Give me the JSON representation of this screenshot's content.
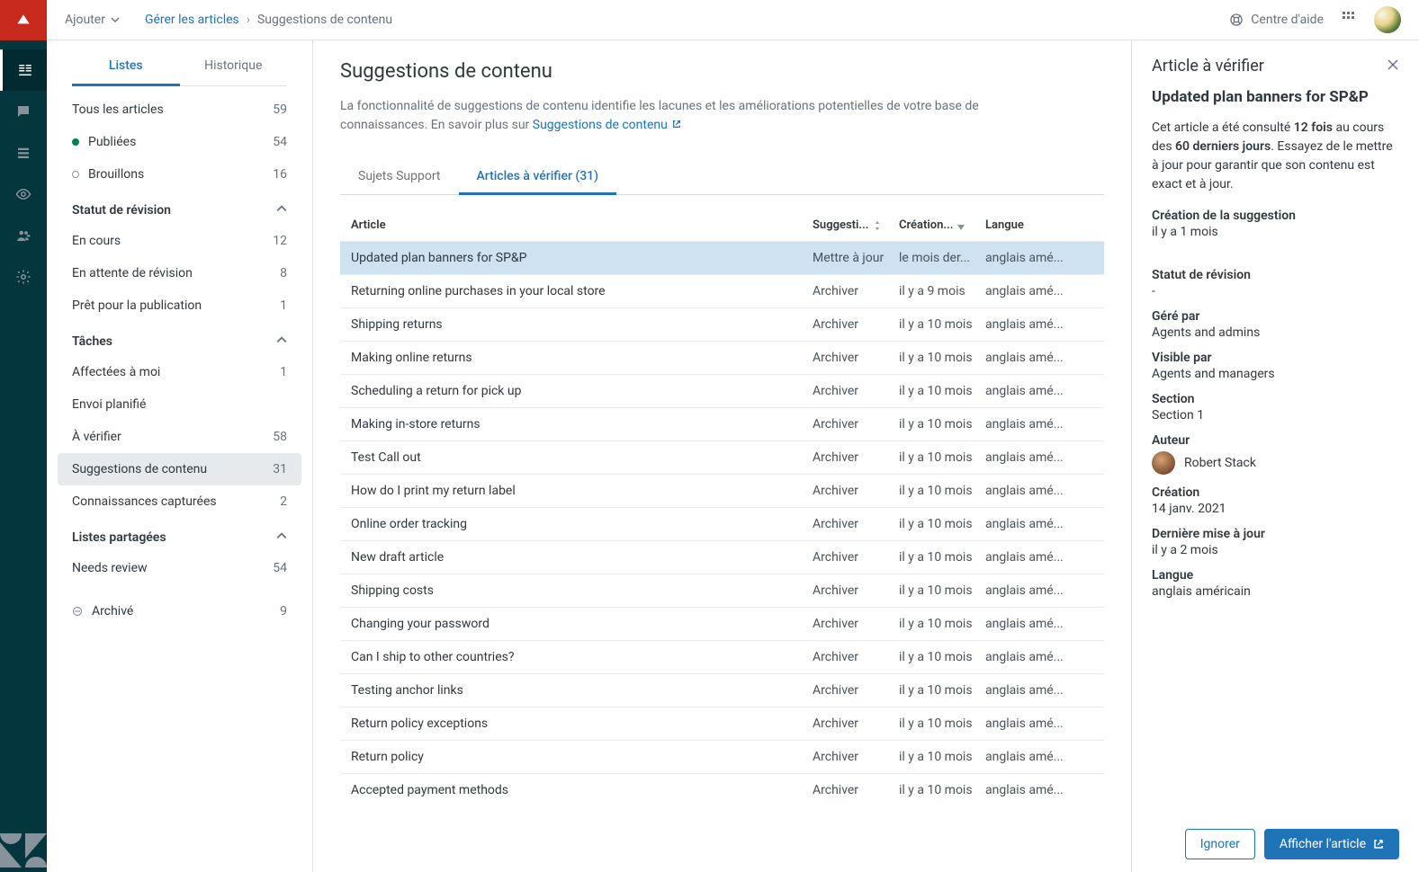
{
  "topbar": {
    "add_label": "Ajouter",
    "breadcrumb_link": "Gérer les articles",
    "breadcrumb_current": "Suggestions de contenu",
    "help_label": "Centre d'aide"
  },
  "sidebar": {
    "tabs": {
      "lists": "Listes",
      "history": "Historique"
    },
    "all_articles": {
      "label": "Tous les articles",
      "count": "59"
    },
    "published": {
      "label": "Publiées",
      "count": "54"
    },
    "drafts": {
      "label": "Brouillons",
      "count": "16"
    },
    "revision_header": "Statut de révision",
    "revision": [
      {
        "label": "En cours",
        "count": "12"
      },
      {
        "label": "En attente de révision",
        "count": "8"
      },
      {
        "label": "Prêt pour la publication",
        "count": "1"
      }
    ],
    "tasks_header": "Tâches",
    "tasks": [
      {
        "label": "Affectées à moi",
        "count": "1"
      },
      {
        "label": "Envoi planifié",
        "count": ""
      },
      {
        "label": "À vérifier",
        "count": "58"
      },
      {
        "label": "Suggestions de contenu",
        "count": "31"
      },
      {
        "label": "Connaissances capturées",
        "count": "2"
      }
    ],
    "shared_header": "Listes partagées",
    "shared": [
      {
        "label": "Needs review",
        "count": "54"
      }
    ],
    "archived": {
      "label": "Archivé",
      "count": "9"
    }
  },
  "content": {
    "title": "Suggestions de contenu",
    "desc_prefix": "La fonctionnalité de suggestions de contenu identifie les lacunes et les améliorations potentielles de votre base de connaissances. En savoir plus sur ",
    "desc_link": "Suggestions de contenu",
    "tabs": {
      "support": "Sujets Support",
      "verify": "Articles à vérifier (31)"
    },
    "columns": {
      "article": "Article",
      "suggestion": "Suggesti...",
      "creation": "Création...",
      "language": "Langue"
    },
    "rows": [
      {
        "article": "Updated plan banners for SP&P",
        "suggestion": "Mettre à jour",
        "creation": "le mois der...",
        "language": "anglais amé..."
      },
      {
        "article": "Returning online purchases in your local store",
        "suggestion": "Archiver",
        "creation": "il y a 9 mois",
        "language": "anglais amé..."
      },
      {
        "article": "Shipping returns",
        "suggestion": "Archiver",
        "creation": "il y a 10 mois",
        "language": "anglais amé..."
      },
      {
        "article": "Making online returns",
        "suggestion": "Archiver",
        "creation": "il y a 10 mois",
        "language": "anglais amé..."
      },
      {
        "article": "Scheduling a return for pick up",
        "suggestion": "Archiver",
        "creation": "il y a 10 mois",
        "language": "anglais amé..."
      },
      {
        "article": "Making in-store returns",
        "suggestion": "Archiver",
        "creation": "il y a 10 mois",
        "language": "anglais amé..."
      },
      {
        "article": "Test Call out",
        "suggestion": "Archiver",
        "creation": "il y a 10 mois",
        "language": "anglais amé..."
      },
      {
        "article": "How do I print my return label",
        "suggestion": "Archiver",
        "creation": "il y a 10 mois",
        "language": "anglais amé..."
      },
      {
        "article": "Online order tracking",
        "suggestion": "Archiver",
        "creation": "il y a 10 mois",
        "language": "anglais amé..."
      },
      {
        "article": "New draft article",
        "suggestion": "Archiver",
        "creation": "il y a 10 mois",
        "language": "anglais amé..."
      },
      {
        "article": "Shipping costs",
        "suggestion": "Archiver",
        "creation": "il y a 10 mois",
        "language": "anglais amé..."
      },
      {
        "article": "Changing your password",
        "suggestion": "Archiver",
        "creation": "il y a 10 mois",
        "language": "anglais amé..."
      },
      {
        "article": "Can I ship to other countries?",
        "suggestion": "Archiver",
        "creation": "il y a 10 mois",
        "language": "anglais amé..."
      },
      {
        "article": "Testing anchor links",
        "suggestion": "Archiver",
        "creation": "il y a 10 mois",
        "language": "anglais amé..."
      },
      {
        "article": "Return policy exceptions",
        "suggestion": "Archiver",
        "creation": "il y a 10 mois",
        "language": "anglais amé..."
      },
      {
        "article": "Return policy",
        "suggestion": "Archiver",
        "creation": "il y a 10 mois",
        "language": "anglais amé..."
      },
      {
        "article": "Accepted payment methods",
        "suggestion": "Archiver",
        "creation": "il y a 10 mois",
        "language": "anglais amé..."
      }
    ]
  },
  "detail": {
    "header": "Article à vérifier",
    "title": "Updated plan banners for SP&P",
    "par_prefix": "Cet article a été consulté ",
    "par_bold1": "12 fois",
    "par_mid": " au cours des ",
    "par_bold2": "60 derniers jours",
    "par_suffix": ". Essayez de le mettre à jour pour garantir que son contenu est exact et à jour.",
    "suggestion_creation_label": "Création de la suggestion",
    "suggestion_creation_val": "il y a 1 mois",
    "revision_status_label": "Statut de révision",
    "revision_status_val": "-",
    "managed_by_label": "Géré par",
    "managed_by_val": "Agents and admins",
    "visible_by_label": "Visible par",
    "visible_by_val": "Agents and managers",
    "section_label": "Section",
    "section_val": "Section 1",
    "author_label": "Auteur",
    "author_val": "Robert Stack",
    "created_label": "Création",
    "created_val": "14 janv. 2021",
    "updated_label": "Dernière mise à jour",
    "updated_val": "il y a 2 mois",
    "language_label": "Langue",
    "language_val": "anglais américain",
    "ignore_btn": "Ignorer",
    "view_btn": "Afficher l'article"
  }
}
